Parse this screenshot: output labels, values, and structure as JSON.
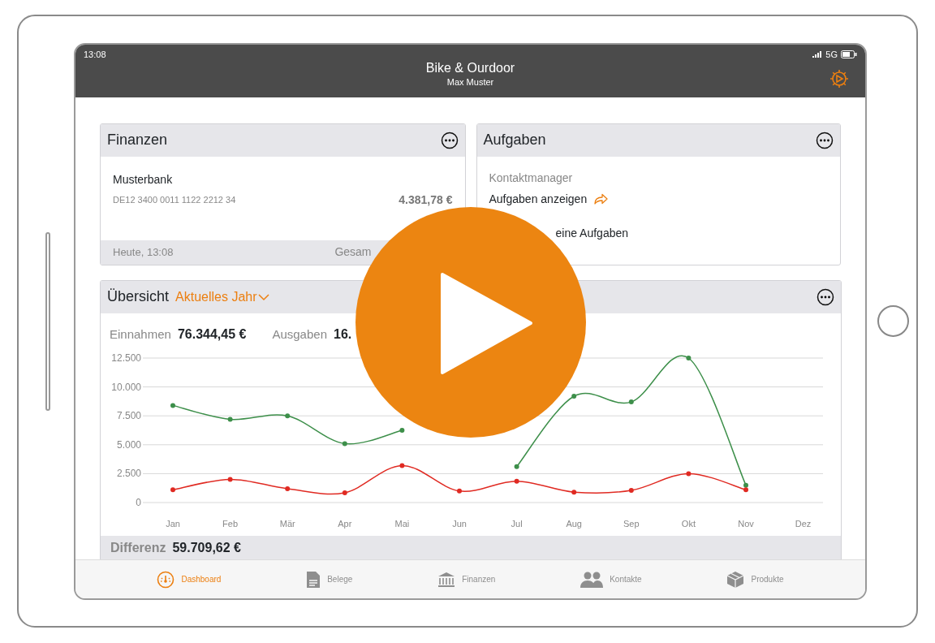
{
  "status_bar": {
    "time": "13:08",
    "network": "5G"
  },
  "header": {
    "title": "Bike & Ourdoor",
    "subtitle": "Max Muster"
  },
  "finance_card": {
    "title": "Finanzen",
    "account": {
      "name": "Musterbank",
      "iban": "DE12 3400 0011 1122 2212 34",
      "balance": "4.381,78 €"
    },
    "footer": {
      "updated": "Heute, 13:08",
      "total_label": "Gesam"
    }
  },
  "tasks_card": {
    "title": "Aufgaben",
    "section": "Kontaktmanager",
    "link": "Aufgaben anzeigen",
    "message": "eine Aufgaben"
  },
  "overview": {
    "title": "Übersicht",
    "period": "Aktuelles Jahr",
    "income": "76.344,45 €",
    "expenses": "16.",
    "chart_data": {
      "type": "line",
      "grid": true,
      "categories": [
        "Jan",
        "Feb",
        "Mär",
        "Apr",
        "Mai",
        "Jun",
        "Jul",
        "Aug",
        "Sep",
        "Okt",
        "Nov",
        "Dez"
      ],
      "ylim": [
        0,
        12500
      ],
      "yticks": [
        {
          "value": 0,
          "label": "0"
        },
        {
          "value": 2500,
          "label": "2.500"
        },
        {
          "value": 5000,
          "label": "5.000"
        },
        {
          "value": 7500,
          "label": "7.500"
        },
        {
          "value": 10000,
          "label": "10.000"
        },
        {
          "value": 12500,
          "label": "12.500"
        }
      ],
      "series": [
        {
          "name": "Einnahmen",
          "color": "#3d8f4a",
          "marker": true,
          "values": [
            8400,
            7200,
            7500,
            5100,
            6250,
            null,
            3100,
            9200,
            8700,
            12500,
            1500,
            null
          ]
        },
        {
          "name": "Ausgaben",
          "color": "#e02a22",
          "marker": true,
          "values": [
            1100,
            2000,
            1200,
            850,
            3200,
            1000,
            1850,
            900,
            1050,
            2500,
            1100,
            null
          ]
        }
      ]
    },
    "difference_label": "Differenz",
    "difference": "59.709,62 €"
  },
  "tab_bar": [
    {
      "label": "Dashboard",
      "selected": true
    },
    {
      "label": "Belege",
      "selected": false
    },
    {
      "label": "Finanzen",
      "selected": false
    },
    {
      "label": "Kontakte",
      "selected": false
    },
    {
      "label": "Produkte",
      "selected": false
    }
  ]
}
